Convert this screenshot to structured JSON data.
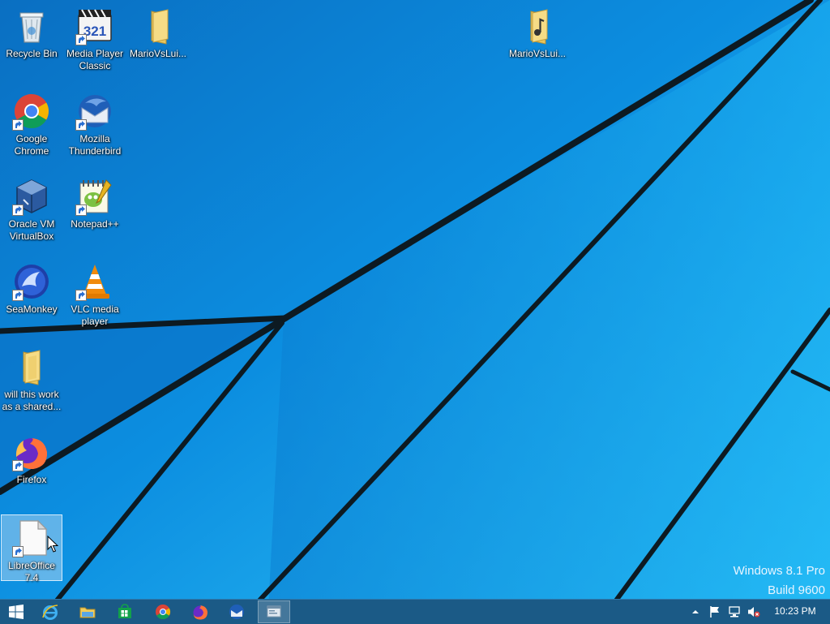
{
  "desktop": {
    "icons": [
      {
        "label": "Recycle Bin",
        "icon": "recycle-bin-icon",
        "shortcut": false
      },
      {
        "label": "Media Player Classic",
        "icon": "media-player-classic-icon",
        "shortcut": true
      },
      {
        "label": "MarioVsLui...",
        "icon": "folder-icon",
        "shortcut": false
      },
      {
        "label": "Google Chrome",
        "icon": "chrome-icon",
        "shortcut": true
      },
      {
        "label": "Mozilla Thunderbird",
        "icon": "thunderbird-icon",
        "shortcut": true
      },
      {
        "label": "Oracle VM VirtualBox",
        "icon": "virtualbox-icon",
        "shortcut": true
      },
      {
        "label": "Notepad++",
        "icon": "notepadpp-icon",
        "shortcut": true
      },
      {
        "label": "SeaMonkey",
        "icon": "seamonkey-icon",
        "shortcut": true
      },
      {
        "label": "VLC media player",
        "icon": "vlc-icon",
        "shortcut": true
      },
      {
        "label": "will this work as a shared...",
        "icon": "folder-icon",
        "shortcut": false
      },
      {
        "label": "Firefox",
        "icon": "firefox-icon",
        "shortcut": true
      },
      {
        "label": "LibreOffice 7.4",
        "icon": "libreoffice-icon",
        "shortcut": true,
        "selected": true
      },
      {
        "label": "MarioVsLui...",
        "icon": "folder-music-icon",
        "shortcut": false
      }
    ]
  },
  "watermark": {
    "edition": "Windows 8.1 Pro",
    "build": "Build 9600"
  },
  "taskbar": {
    "buttons": [
      {
        "name": "start-button",
        "icon": "windows-logo-icon"
      },
      {
        "name": "internet-explorer-button",
        "icon": "internet-explorer-icon"
      },
      {
        "name": "file-explorer-button",
        "icon": "file-explorer-icon"
      },
      {
        "name": "store-button",
        "icon": "store-icon"
      },
      {
        "name": "chrome-button",
        "icon": "chrome-icon"
      },
      {
        "name": "firefox-button",
        "icon": "firefox-icon"
      },
      {
        "name": "thunderbird-button",
        "icon": "thunderbird-icon"
      },
      {
        "name": "active-window-button",
        "icon": "window-icon",
        "active": true
      }
    ],
    "tray": {
      "icons": [
        "chevron-up-icon",
        "action-center-flag-icon",
        "network-icon",
        "volume-muted-icon"
      ],
      "clock": "10:23 PM"
    }
  },
  "colors": {
    "wallpaper_light": "#26bdf6",
    "wallpaper_dark": "#0a6fc2",
    "taskbar": "#1b5a86"
  }
}
